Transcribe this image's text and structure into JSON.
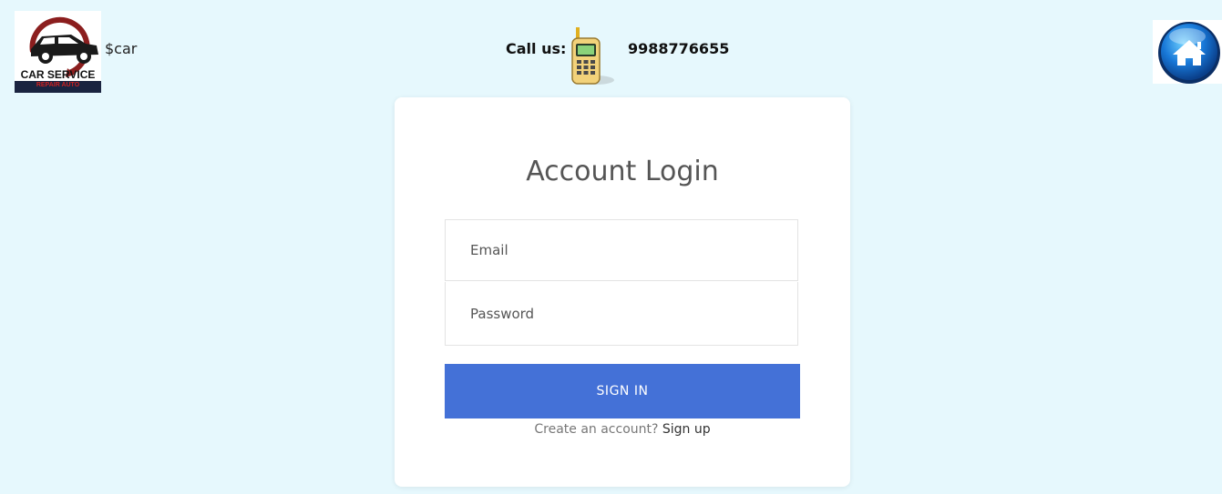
{
  "header": {
    "logo": {
      "line1": "CAR SERVICE",
      "line2": "REPAIR AUTO",
      "icon": "car-logo-icon"
    },
    "brand_var": "$car",
    "call_label": "Call us:",
    "phone_icon": "mobile-phone-icon",
    "phone_number": "9988776655",
    "home_icon": "home-icon"
  },
  "login": {
    "title": "Account Login",
    "email_placeholder": "Email",
    "password_placeholder": "Password",
    "signin_label": "SIGN IN",
    "signup_prompt": "Create an account?",
    "signup_link": "Sign up"
  },
  "colors": {
    "background": "#e6f8fd",
    "primary_button": "#4471d7",
    "card": "#ffffff"
  }
}
